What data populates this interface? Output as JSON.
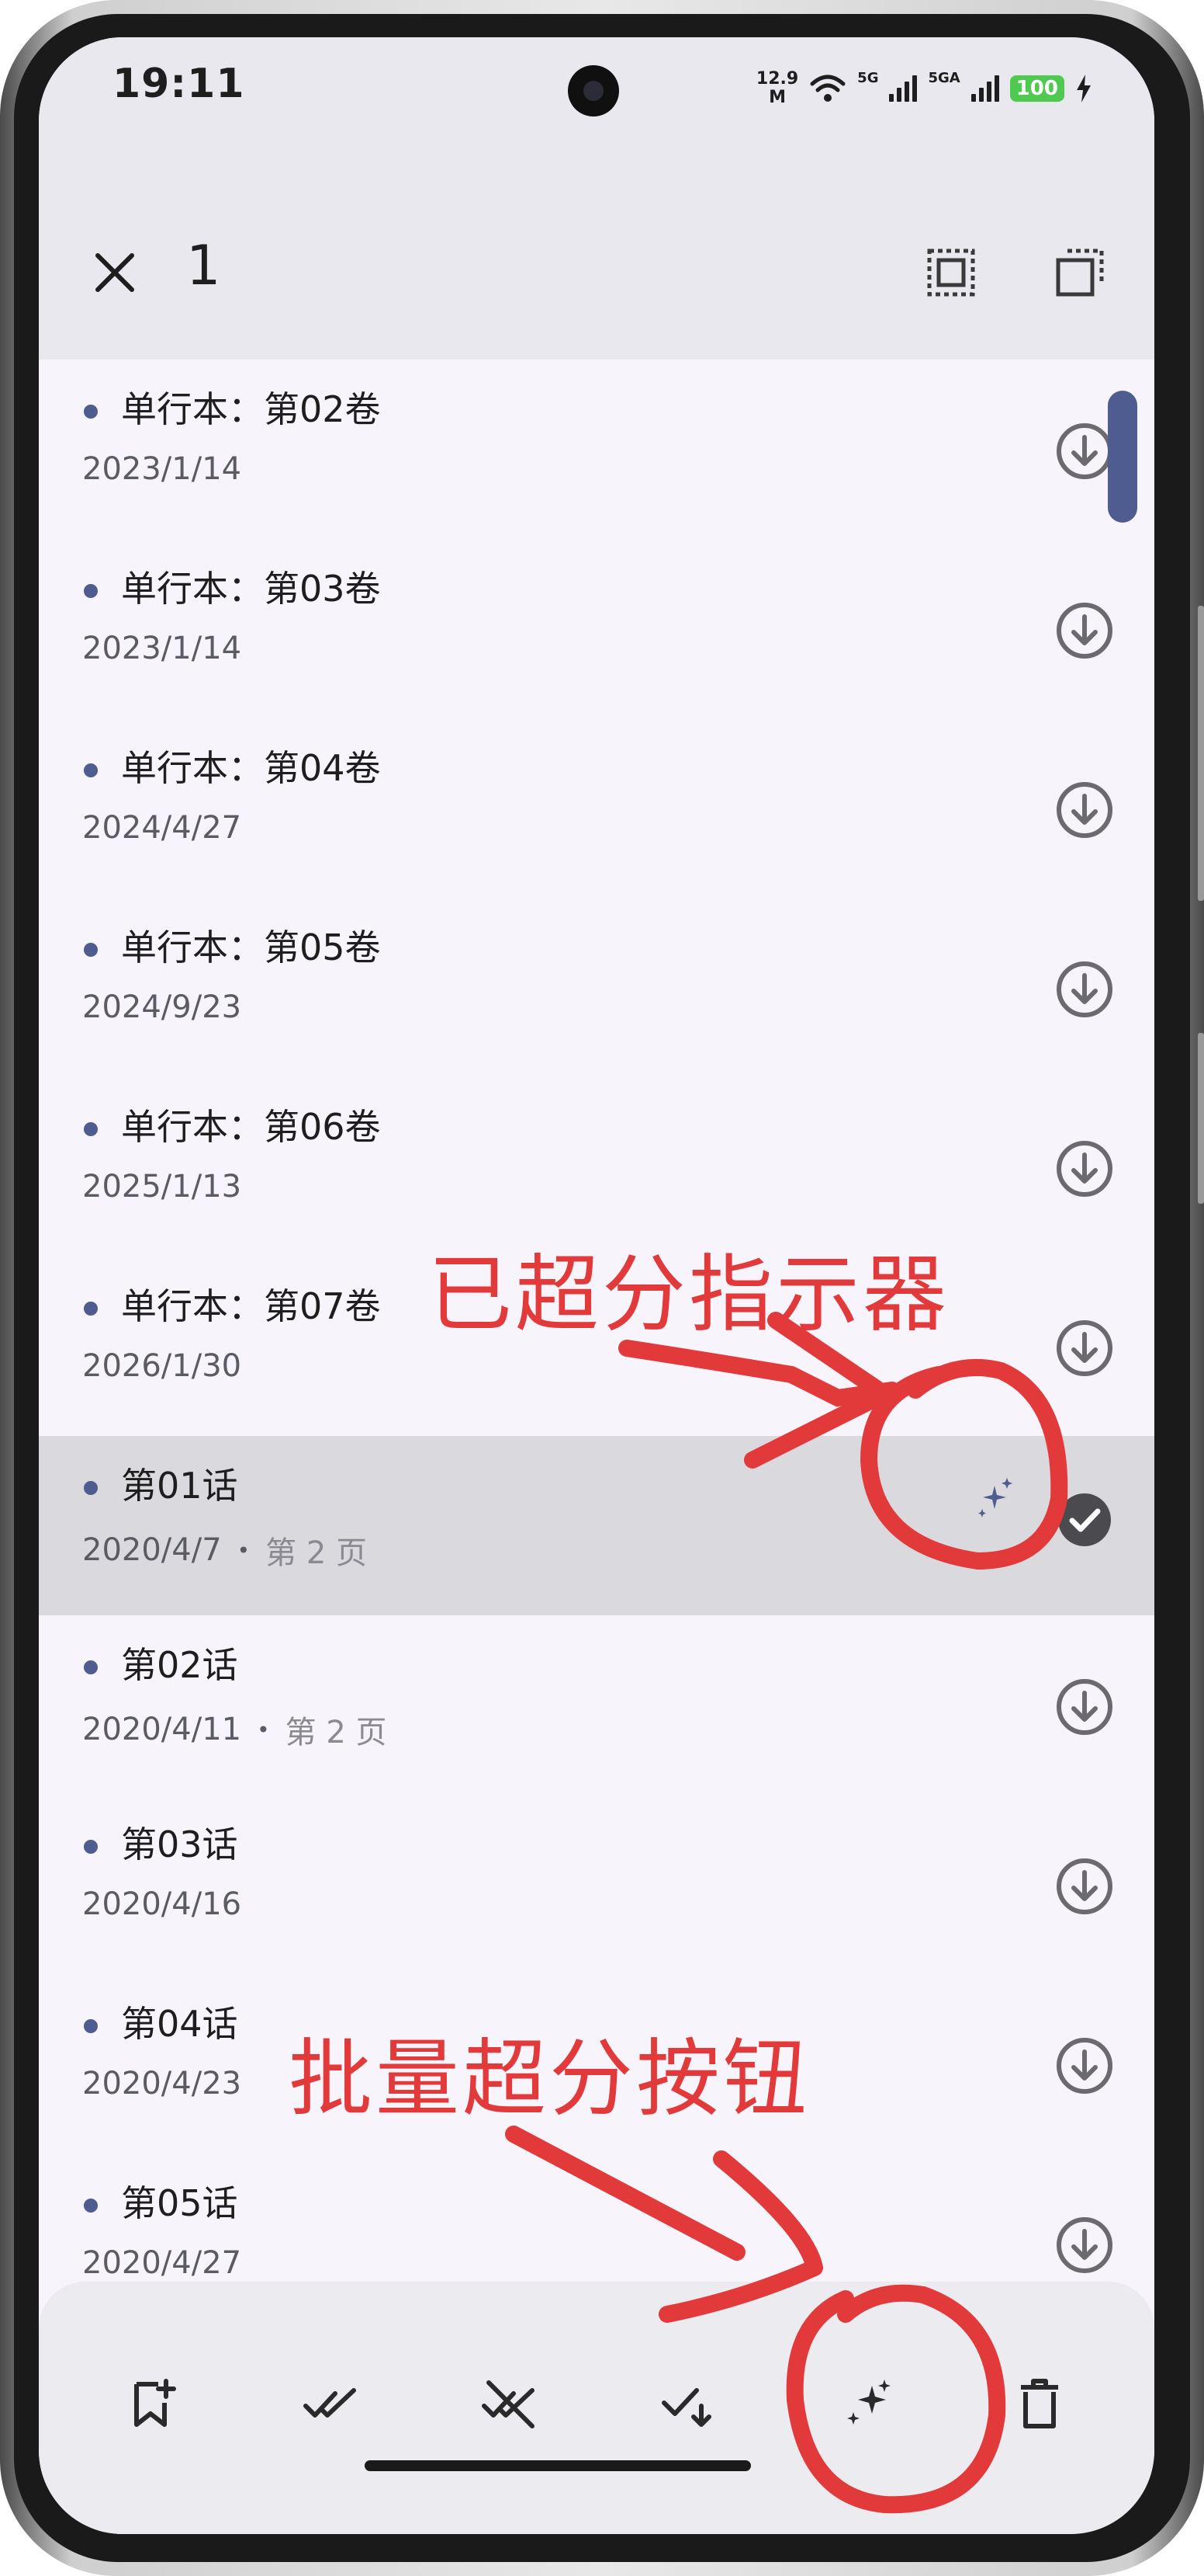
{
  "status": {
    "time": "19:11",
    "net_speed_value": "12.9",
    "net_speed_unit": "M",
    "sig1": "5G",
    "sig2": "5GA",
    "battery": "100"
  },
  "topbar": {
    "selected_count": "1"
  },
  "items": [
    {
      "title": "单行本：第02卷",
      "date": "2023/1/14"
    },
    {
      "title": "单行本：第03卷",
      "date": "2023/1/14"
    },
    {
      "title": "单行本：第04卷",
      "date": "2024/4/27"
    },
    {
      "title": "单行本：第05卷",
      "date": "2024/9/23"
    },
    {
      "title": "单行本：第06卷",
      "date": "2025/1/13"
    },
    {
      "title": "单行本：第07卷",
      "date": "2026/1/30"
    },
    {
      "title": "第01话",
      "date": "2020/4/7",
      "separator": "•",
      "page": "第 2 页"
    },
    {
      "title": "第02话",
      "date": "2020/4/11",
      "separator": "•",
      "page": "第 2 页"
    },
    {
      "title": "第03话",
      "date": "2020/4/16"
    },
    {
      "title": "第04话",
      "date": "2020/4/23"
    },
    {
      "title": "第05话",
      "date": "2020/4/27"
    }
  ],
  "annotations": {
    "indicator_label": "已超分指示器",
    "batch_button_label": "批量超分按钮"
  },
  "colors": {
    "accent": "#4e5c8f",
    "annotation": "#e23a3a",
    "selected_row": "#d9d9de"
  }
}
